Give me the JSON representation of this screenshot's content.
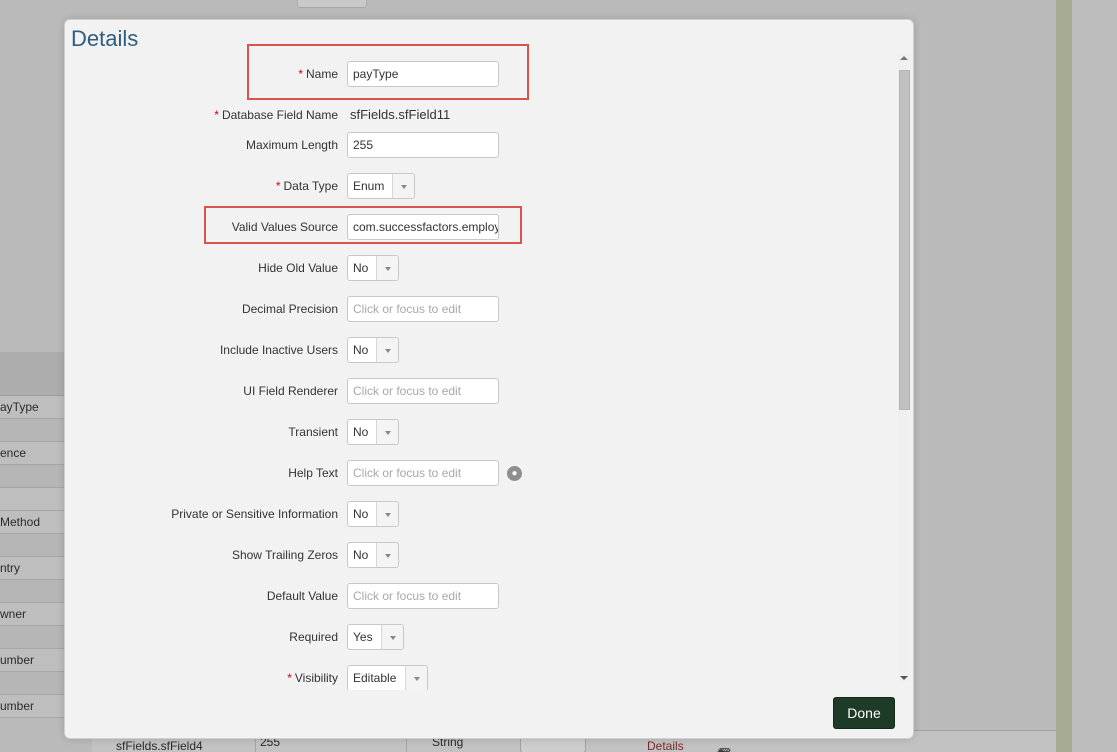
{
  "background": {
    "left_rows": [
      "ayType",
      "",
      "ence",
      "",
      "",
      "Method",
      "",
      "ntry",
      "",
      "wner",
      "",
      "umber",
      "",
      "umber"
    ],
    "bottom_row": {
      "field": "sfFields.sfField4",
      "max_length": "255",
      "data_type": "String",
      "details_link": "Details",
      "icons": [
        "trash-icon",
        "arrows-icon",
        "asterisk-icon"
      ]
    }
  },
  "dialog": {
    "title": "Details",
    "fields": [
      {
        "label": "Name",
        "required": true,
        "type": "text",
        "value": "payType",
        "placeholder": ""
      },
      {
        "label": "Database Field Name",
        "required": true,
        "type": "readonly",
        "value": "sfFields.sfField11"
      },
      {
        "label": "Maximum Length",
        "required": false,
        "type": "text",
        "value": "255",
        "placeholder": ""
      },
      {
        "label": "Data Type",
        "required": true,
        "type": "select",
        "value": "Enum"
      },
      {
        "label": "Valid Values Source",
        "required": false,
        "type": "text",
        "value": "com.successfactors.employ",
        "placeholder": ""
      },
      {
        "label": "Hide Old Value",
        "required": false,
        "type": "select",
        "value": "No"
      },
      {
        "label": "Decimal Precision",
        "required": false,
        "type": "text",
        "value": "",
        "placeholder": "Click or focus to edit"
      },
      {
        "label": "Include Inactive Users",
        "required": false,
        "type": "select",
        "value": "No"
      },
      {
        "label": "UI Field Renderer",
        "required": false,
        "type": "text",
        "value": "",
        "placeholder": "Click or focus to edit"
      },
      {
        "label": "Transient",
        "required": false,
        "type": "select",
        "value": "No"
      },
      {
        "label": "Help Text",
        "required": false,
        "type": "text",
        "value": "",
        "placeholder": "Click or focus to edit",
        "icon": "globe-icon"
      },
      {
        "label": "Private or Sensitive Information",
        "required": false,
        "type": "select",
        "value": "No"
      },
      {
        "label": "Show Trailing Zeros",
        "required": false,
        "type": "select",
        "value": "No"
      },
      {
        "label": "Default Value",
        "required": false,
        "type": "text",
        "value": "",
        "placeholder": "Click or focus to edit"
      },
      {
        "label": "Required",
        "required": false,
        "type": "select",
        "value": "Yes"
      },
      {
        "label": "Visibility",
        "required": true,
        "type": "select",
        "value": "Editable"
      }
    ],
    "done_label": "Done",
    "highlighted_fields": [
      "Name",
      "Valid Values Source"
    ]
  },
  "colors": {
    "title": "#2e5d7d",
    "required_star": "#d0021b",
    "highlight": "#d9534f",
    "done_button": "#1e3b28"
  }
}
